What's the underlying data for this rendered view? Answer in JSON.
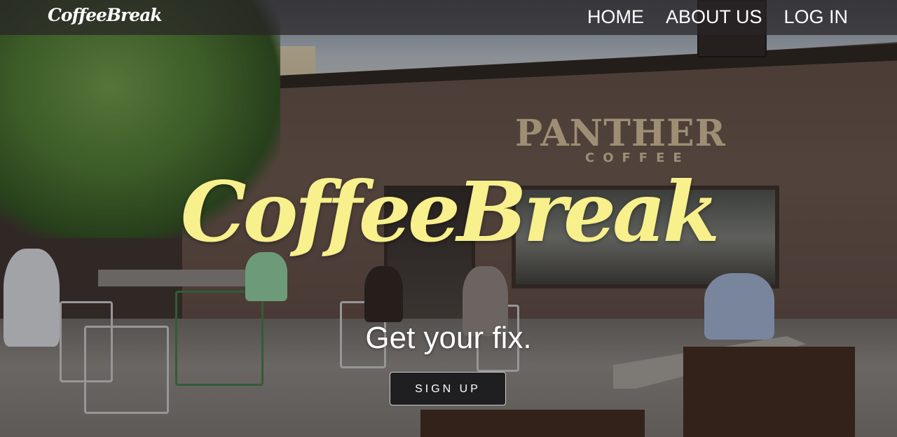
{
  "navbar": {
    "brand": "CoffeeBreak",
    "links": [
      {
        "label": "HOME"
      },
      {
        "label": "ABOUT US"
      },
      {
        "label": "LOG IN"
      }
    ]
  },
  "hero": {
    "title": "CoffeeBreak",
    "subtitle": "Get your fix.",
    "cta_label": "SIGN UP",
    "background_sign": {
      "name": "PANTHER",
      "sub": "COFFEE"
    }
  },
  "colors": {
    "title": "#f7f08c",
    "navbar_bg": "#282426",
    "button_bg": "#1f1f21"
  }
}
